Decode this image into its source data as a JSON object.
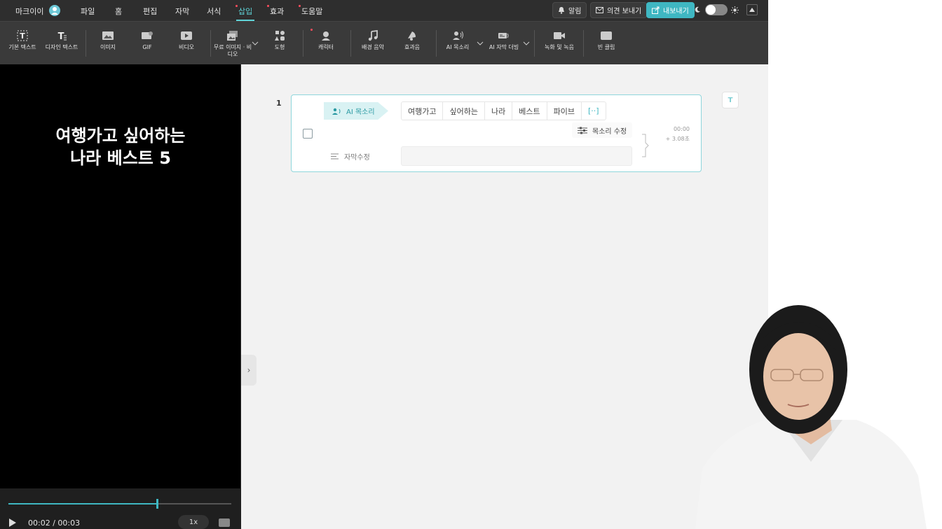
{
  "menubar": {
    "user": "마크이이",
    "items": [
      "파일",
      "홈",
      "편집",
      "자막",
      "서식",
      "삽입",
      "효과",
      "도움말"
    ],
    "active": "삽입",
    "notify": "알림",
    "feedback": "의견 보내기",
    "export": "내보내기"
  },
  "toolbar": {
    "tools": [
      {
        "label": "기본 텍스트",
        "icon": "text-icon"
      },
      {
        "label": "디자인 텍스트",
        "icon": "design-text-icon"
      },
      {
        "label": "이미지",
        "icon": "image-icon"
      },
      {
        "label": "GIF",
        "icon": "gif-icon"
      },
      {
        "label": "비디오",
        "icon": "video-icon"
      },
      {
        "label": "무료 이미지 · 비디오",
        "icon": "stock-media-icon"
      },
      {
        "label": "도형",
        "icon": "shapes-icon"
      },
      {
        "label": "캐릭터",
        "icon": "character-icon"
      },
      {
        "label": "배경 음악",
        "icon": "music-icon"
      },
      {
        "label": "효과음",
        "icon": "sound-effect-icon"
      },
      {
        "label": "AI 목소리",
        "icon": "ai-voice-icon"
      },
      {
        "label": "AI 자막 더빙",
        "icon": "ai-dubbing-icon"
      },
      {
        "label": "녹화 및 녹음",
        "icon": "record-icon"
      },
      {
        "label": "빈 클립",
        "icon": "blank-clip-icon"
      }
    ]
  },
  "preview": {
    "title_line1": "여행가고 싶어하는",
    "title_line2": "나라 베스트 5",
    "time": "00:02 / 00:03",
    "progress": 0.667,
    "speed": "1x"
  },
  "editor": {
    "row_number": "1",
    "ai_voice_label": "AI 목소리",
    "words": [
      "여행가고",
      "싶어하는",
      "나라",
      "베스트",
      "파이브",
      "[··]"
    ],
    "voice_edit_label": "목소리 수정",
    "subtitle_edit_label": "자막수정",
    "subtitle_value": "",
    "time_start": "00:00",
    "duration": "+  3.08초"
  },
  "colors": {
    "accent": "#3fb7c2",
    "menubar": "#2e2e2e",
    "toolbar": "#3a3a3a"
  }
}
